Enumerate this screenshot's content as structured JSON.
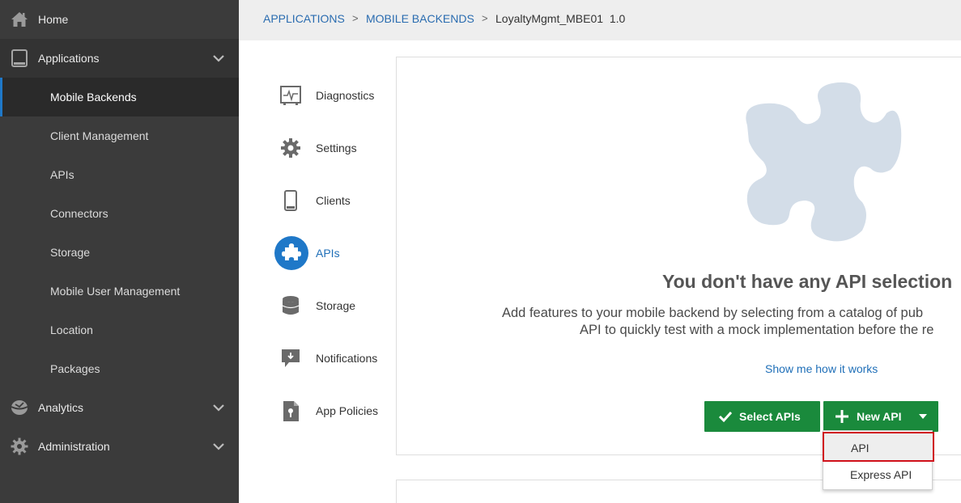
{
  "sidebar": {
    "home": "Home",
    "applications": "Applications",
    "app_items": [
      "Mobile Backends",
      "Client Management",
      "APIs",
      "Connectors",
      "Storage",
      "Mobile User Management",
      "Location",
      "Packages"
    ],
    "analytics": "Analytics",
    "administration": "Administration"
  },
  "breadcrumb": {
    "applications": "APPLICATIONS",
    "sep": ">",
    "mobile_backends": "MOBILE BACKENDS",
    "current": "LoyaltyMgmt_MBE01  1.0"
  },
  "midnav": {
    "items": [
      {
        "label": "Diagnostics",
        "icon": "diagnostics-icon"
      },
      {
        "label": "Settings",
        "icon": "gear-icon"
      },
      {
        "label": "Clients",
        "icon": "phone-icon"
      },
      {
        "label": "APIs",
        "icon": "puzzle-icon"
      },
      {
        "label": "Storage",
        "icon": "database-icon"
      },
      {
        "label": "Notifications",
        "icon": "notification-icon"
      },
      {
        "label": "App Policies",
        "icon": "policy-icon"
      }
    ]
  },
  "main": {
    "headline": "You don't have any API selection",
    "desc_line1": "Add features to your mobile backend by selecting from a catalog of pub",
    "desc_line2": "API to quickly test with a mock implementation before the re",
    "show_me": "Show me how it works",
    "select_apis": "Select APIs",
    "new_api": "New API"
  },
  "dropdown": {
    "items": [
      "API",
      "Express API"
    ]
  },
  "colors": {
    "sidebar_bg": "#3b3b3b",
    "accent_blue": "#1f78c8",
    "button_green": "#1a8a3c",
    "highlight_red": "#d0101a",
    "puzzle_fill": "#d3dde8"
  }
}
